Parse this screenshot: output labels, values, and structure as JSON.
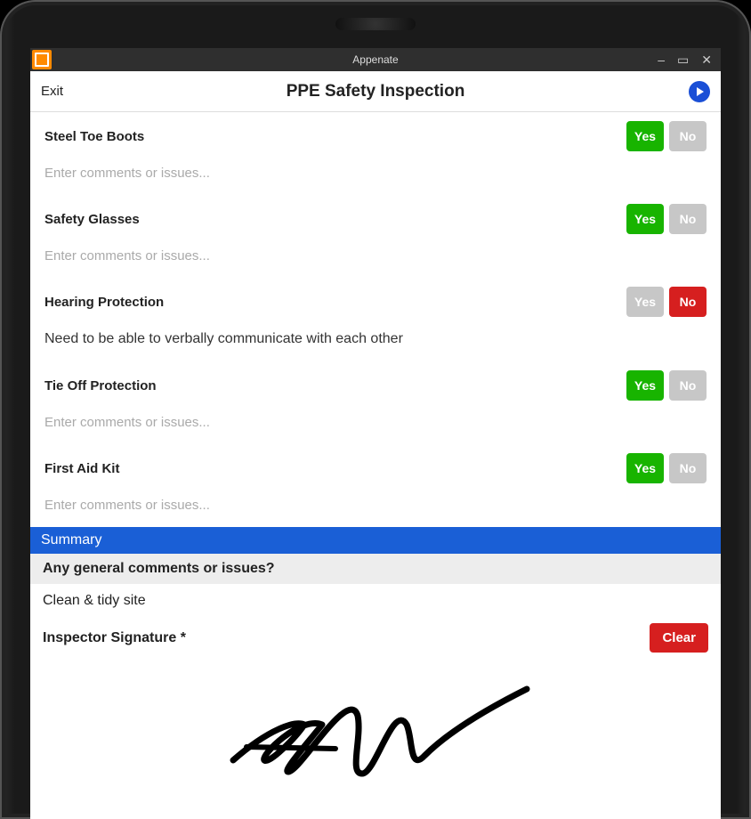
{
  "window": {
    "title": "Appenate"
  },
  "header": {
    "exit_label": "Exit",
    "page_title": "PPE Safety Inspection"
  },
  "items": [
    {
      "label": "Steel Toe Boots",
      "yes_label": "Yes",
      "no_label": "No",
      "selected": "yes",
      "comment_placeholder": "Enter comments or issues...",
      "comment_value": ""
    },
    {
      "label": "Safety Glasses",
      "yes_label": "Yes",
      "no_label": "No",
      "selected": "yes",
      "comment_placeholder": "Enter comments or issues...",
      "comment_value": ""
    },
    {
      "label": "Hearing Protection",
      "yes_label": "Yes",
      "no_label": "No",
      "selected": "no",
      "comment_placeholder": "Enter comments or issues...",
      "comment_value": "Need to be able to verbally communicate with each other"
    },
    {
      "label": "Tie Off Protection",
      "yes_label": "Yes",
      "no_label": "No",
      "selected": "yes",
      "comment_placeholder": "Enter comments or issues...",
      "comment_value": ""
    },
    {
      "label": "First Aid Kit",
      "yes_label": "Yes",
      "no_label": "No",
      "selected": "yes",
      "comment_placeholder": "Enter comments or issues...",
      "comment_value": ""
    }
  ],
  "summary": {
    "header": "Summary",
    "question": "Any general comments or issues?",
    "answer": "Clean & tidy site",
    "signature_label": "Inspector Signature *",
    "clear_label": "Clear"
  }
}
